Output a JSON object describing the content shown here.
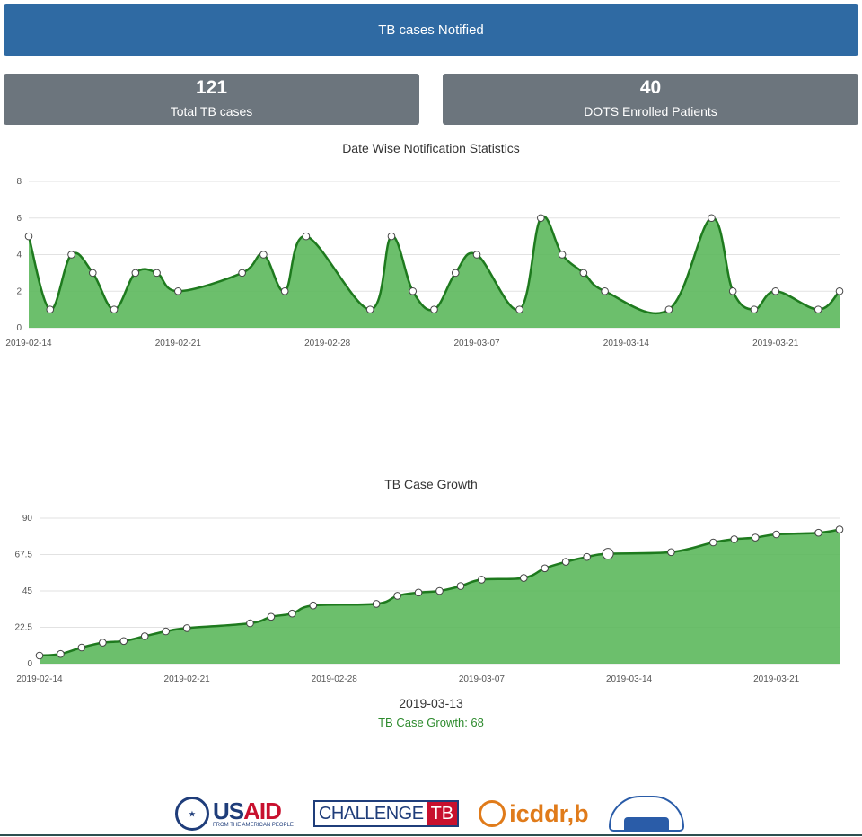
{
  "header": {
    "title": "TB cases Notified"
  },
  "stats": [
    {
      "value": "121",
      "label": "Total TB cases"
    },
    {
      "value": "40",
      "label": "DOTS Enrolled Patients"
    }
  ],
  "chart_data": [
    {
      "type": "area",
      "title": "Date Wise Notification Statistics",
      "xlabel": "",
      "ylabel": "",
      "ylim": [
        0,
        8
      ],
      "yticks": [
        "0",
        "2",
        "4",
        "6",
        "8"
      ],
      "xticks": [
        "2019-02-14",
        "2019-02-21",
        "2019-02-28",
        "2019-03-07",
        "2019-03-14",
        "2019-03-21"
      ],
      "x": [
        "2019-02-14",
        "2019-02-15",
        "2019-02-16",
        "2019-02-17",
        "2019-02-18",
        "2019-02-19",
        "2019-02-20",
        "2019-02-21",
        "2019-02-24",
        "2019-02-25",
        "2019-02-26",
        "2019-02-27",
        "2019-03-02",
        "2019-03-03",
        "2019-03-04",
        "2019-03-05",
        "2019-03-06",
        "2019-03-07",
        "2019-03-09",
        "2019-03-10",
        "2019-03-11",
        "2019-03-12",
        "2019-03-13",
        "2019-03-16",
        "2019-03-18",
        "2019-03-19",
        "2019-03-20",
        "2019-03-21",
        "2019-03-23",
        "2019-03-24"
      ],
      "values": [
        5,
        1,
        4,
        3,
        1,
        3,
        3,
        2,
        3,
        4,
        2,
        5,
        1,
        5,
        2,
        1,
        3,
        4,
        1,
        6,
        4,
        3,
        2,
        1,
        6,
        2,
        1,
        2,
        1,
        2
      ],
      "color": "#5cb85c",
      "line_color": "#1e7a1e",
      "grid": true
    },
    {
      "type": "area",
      "title": "TB Case Growth",
      "xlabel": "",
      "ylabel": "",
      "ylim": [
        0,
        90
      ],
      "yticks": [
        "0",
        "22.5",
        "45",
        "67.5",
        "90"
      ],
      "xticks": [
        "2019-02-14",
        "2019-02-21",
        "2019-02-28",
        "2019-03-07",
        "2019-03-14",
        "2019-03-21"
      ],
      "x": [
        "2019-02-14",
        "2019-02-15",
        "2019-02-16",
        "2019-02-17",
        "2019-02-18",
        "2019-02-19",
        "2019-02-20",
        "2019-02-21",
        "2019-02-24",
        "2019-02-25",
        "2019-02-26",
        "2019-02-27",
        "2019-03-02",
        "2019-03-03",
        "2019-03-04",
        "2019-03-05",
        "2019-03-06",
        "2019-03-07",
        "2019-03-09",
        "2019-03-10",
        "2019-03-11",
        "2019-03-12",
        "2019-03-13",
        "2019-03-16",
        "2019-03-18",
        "2019-03-19",
        "2019-03-20",
        "2019-03-21",
        "2019-03-23",
        "2019-03-24"
      ],
      "values": [
        5,
        6,
        10,
        13,
        14,
        17,
        20,
        22,
        25,
        29,
        31,
        36,
        37,
        42,
        44,
        45,
        48,
        52,
        53,
        59,
        63,
        66,
        68,
        69,
        75,
        77,
        78,
        80,
        81,
        83
      ],
      "color": "#5cb85c",
      "line_color": "#1e7a1e",
      "grid": true,
      "tooltip": {
        "date": "2019-03-13",
        "label": "TB Case Growth: 68"
      }
    }
  ],
  "footer": {
    "logos": [
      {
        "name": "USAID",
        "part1": "US",
        "part2": "AID",
        "sub": "FROM THE AMERICAN PEOPLE"
      },
      {
        "name": "CHALLENGE TB",
        "part1": "CHALLENGE",
        "part2": "TB"
      },
      {
        "name": "icddr,b",
        "text": "icddr,b"
      },
      {
        "name": "bangladesh-govt-logo"
      }
    ]
  }
}
